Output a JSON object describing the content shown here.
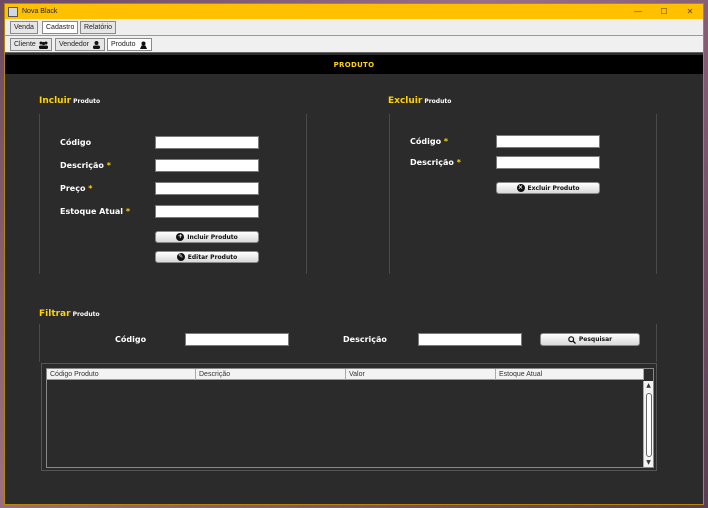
{
  "window": {
    "title": "Nova Black",
    "controls": [
      "—",
      "☐",
      "✕"
    ]
  },
  "menu_tabs": [
    {
      "label": "Venda",
      "selected": false
    },
    {
      "label": "Cadastro",
      "selected": true
    },
    {
      "label": "Relatório",
      "selected": false
    }
  ],
  "sub_tabs": [
    {
      "label": "Cliente",
      "icon": "group-icon",
      "selected": false
    },
    {
      "label": "Vendedor",
      "icon": "user-icon",
      "selected": false
    },
    {
      "label": "Produto",
      "icon": "product-icon",
      "selected": true
    }
  ],
  "header": {
    "title": "PRODUTO"
  },
  "incluir": {
    "title": "Incluir",
    "subtitle": "Produto",
    "fields": [
      {
        "label": "Código",
        "required": false,
        "value": ""
      },
      {
        "label": "Descrição",
        "required": true,
        "value": ""
      },
      {
        "label": "Preço",
        "required": true,
        "value": ""
      },
      {
        "label": "Estoque Atual",
        "required": true,
        "value": ""
      }
    ],
    "include_button": "Incluir Produto",
    "edit_button": "Editar Produto"
  },
  "excluir": {
    "title": "Excluir",
    "subtitle": "Produto",
    "fields": [
      {
        "label": "Código",
        "required": true,
        "value": ""
      },
      {
        "label": "Descrição",
        "required": true,
        "value": ""
      }
    ],
    "delete_button": "Excluir Produto"
  },
  "filtrar": {
    "title": "Filtrar",
    "subtitle": "Produto",
    "codigo_label": "Código",
    "codigo_value": "",
    "descricao_label": "Descrição",
    "descricao_value": "",
    "search_button": "Pesquisar"
  },
  "table": {
    "columns": [
      "Código Produto",
      "Descrição",
      "Valor",
      "Estoque Atual"
    ],
    "rows": []
  },
  "colors": {
    "accent": "#ffd200",
    "titlebar": "#ffc000",
    "background": "#2b2b2b"
  },
  "required_mark": "*"
}
